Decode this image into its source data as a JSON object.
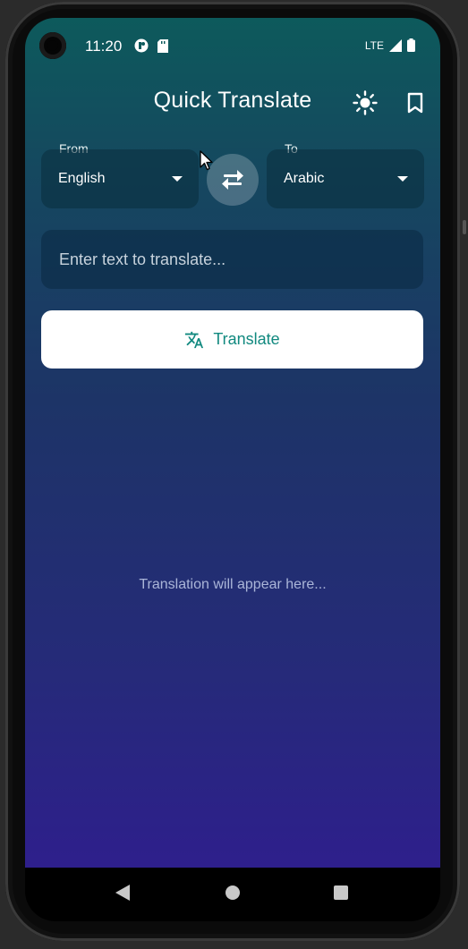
{
  "status_bar": {
    "time": "11:20",
    "network": "LTE"
  },
  "app_bar": {
    "title": "Quick Translate",
    "theme_icon": "sun-icon",
    "bookmark_icon": "bookmark-icon"
  },
  "language_selector": {
    "from_label": "From",
    "from_value": "English",
    "to_label": "To",
    "to_value": "Arabic",
    "swap_icon": "swap-arrows-icon"
  },
  "input": {
    "placeholder": "Enter text to translate..."
  },
  "translate_button": {
    "label": "Translate",
    "icon": "translate-icon"
  },
  "result": {
    "placeholder": "Translation will appear here..."
  },
  "colors": {
    "accent": "#11897f",
    "gradient_top": "#0d5a5c",
    "gradient_bottom": "#2e1f8c"
  }
}
